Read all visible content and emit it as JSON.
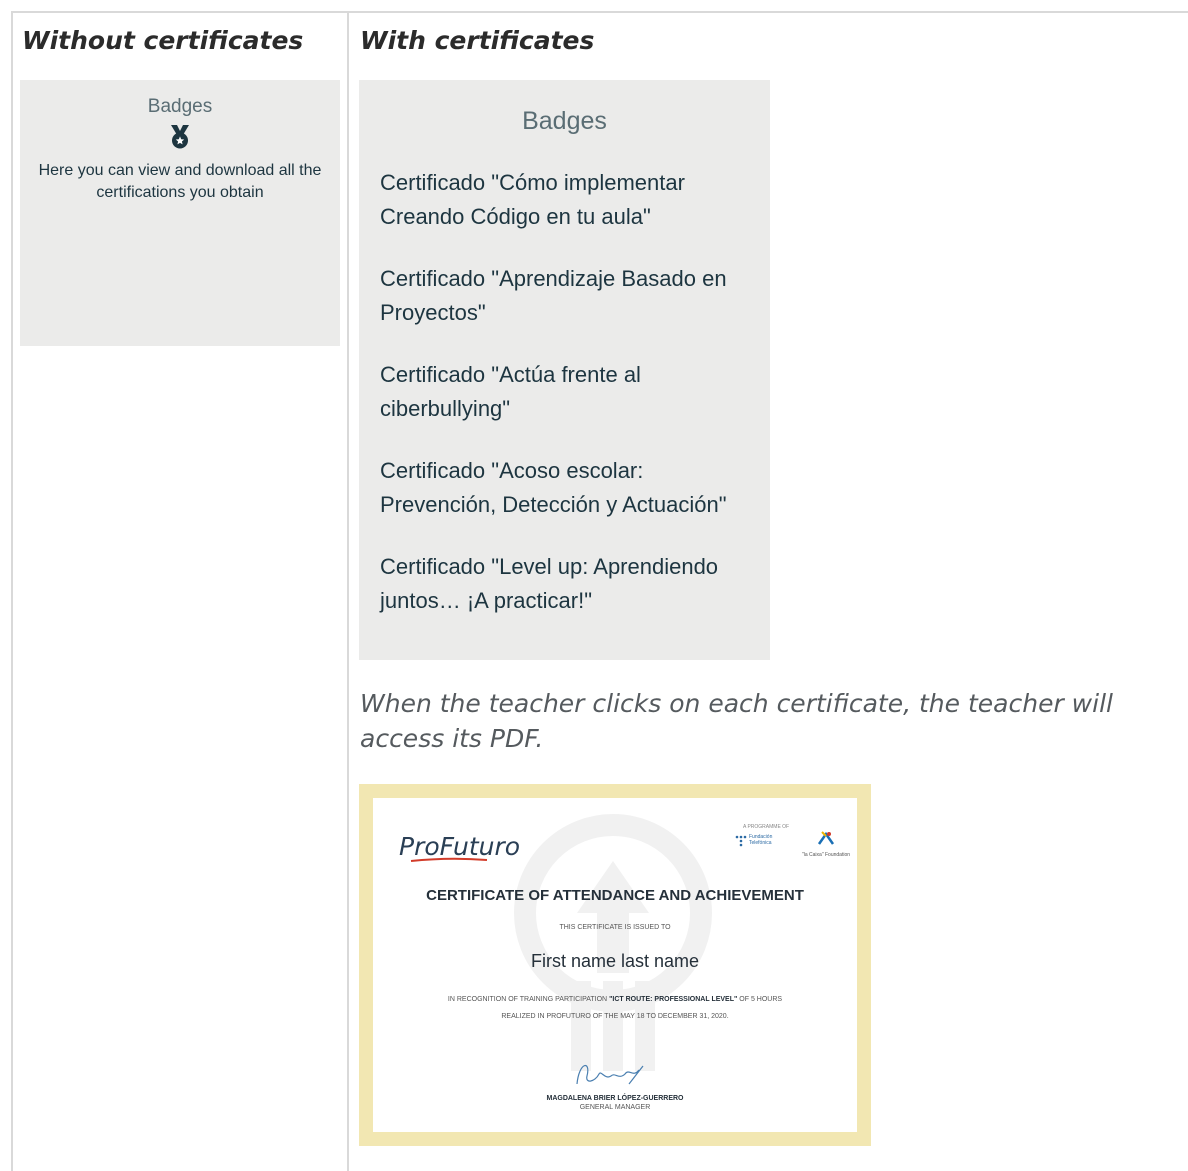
{
  "columns": {
    "left_heading": "Without certificates",
    "right_heading": "With certificates"
  },
  "empty_state": {
    "title": "Badges",
    "icon": "medal-icon",
    "description": "Here you can view and download all the certifications you obtain"
  },
  "badges": {
    "title": "Badges",
    "certificates": [
      "Certificado \"Cómo implementar Creando Código en tu aula\"",
      "Certificado \"Aprendizaje Basado en Proyectos\"",
      "Certificado \"Actúa frente al ciberbullying\"",
      "Certificado \"Acoso escolar: Prevención, Detección y Actuación\"",
      "Certificado \"Level up: Aprendiendo juntos… ¡A practicar!\""
    ]
  },
  "note": "When the teacher clicks on each certificate, the teacher will access its PDF.",
  "certificate": {
    "logo": "ProFuturo",
    "programme_label": "A PROGRAMME OF",
    "sponsor1": "Fundación Telefónica",
    "sponsor2": "\"la Caixa\" Foundation",
    "title": "CERTIFICATE OF ATTENDANCE AND ACHIEVEMENT",
    "issued_to": "THIS CERTIFICATE IS ISSUED TO",
    "name": "First name last name",
    "body_pre": "IN RECOGNITION OF TRAINING PARTICIPATION",
    "course": "\"ICT ROUTE: PROFESSIONAL LEVEL\"",
    "body_post": "OF 5 HOURS",
    "body_line2": "REALIZED IN PROFUTURO OF THE MAY 18 TO DECEMBER 31, 2020.",
    "signer": "MAGDALENA BRIER LÓPEZ-GUERRERO",
    "signer_role": "GENERAL MANAGER"
  },
  "colors": {
    "panel_bg": "#ebebea",
    "text_dark": "#1d3540",
    "certificate_border": "#f2e7b2"
  }
}
